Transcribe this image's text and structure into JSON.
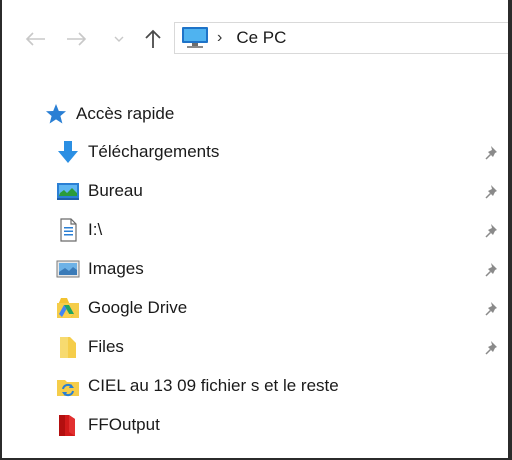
{
  "address": {
    "location": "Ce PC",
    "separator": "›"
  },
  "quick_access": {
    "label": "Accès rapide"
  },
  "items": [
    {
      "label": "Téléchargements",
      "icon": "download-arrow-icon",
      "pinned": true
    },
    {
      "label": "Bureau",
      "icon": "desktop-icon",
      "pinned": true
    },
    {
      "label": "I:\\",
      "icon": "document-icon",
      "pinned": true
    },
    {
      "label": "Images",
      "icon": "pictures-icon",
      "pinned": true
    },
    {
      "label": "Google Drive",
      "icon": "google-drive-icon",
      "pinned": true
    },
    {
      "label": "Files",
      "icon": "folder-icon",
      "pinned": true
    },
    {
      "label": "CIEL au 13 09 fichier s et le reste",
      "icon": "sync-folder-icon",
      "pinned": false
    },
    {
      "label": "FFOutput",
      "icon": "red-folder-icon",
      "pinned": false
    }
  ]
}
